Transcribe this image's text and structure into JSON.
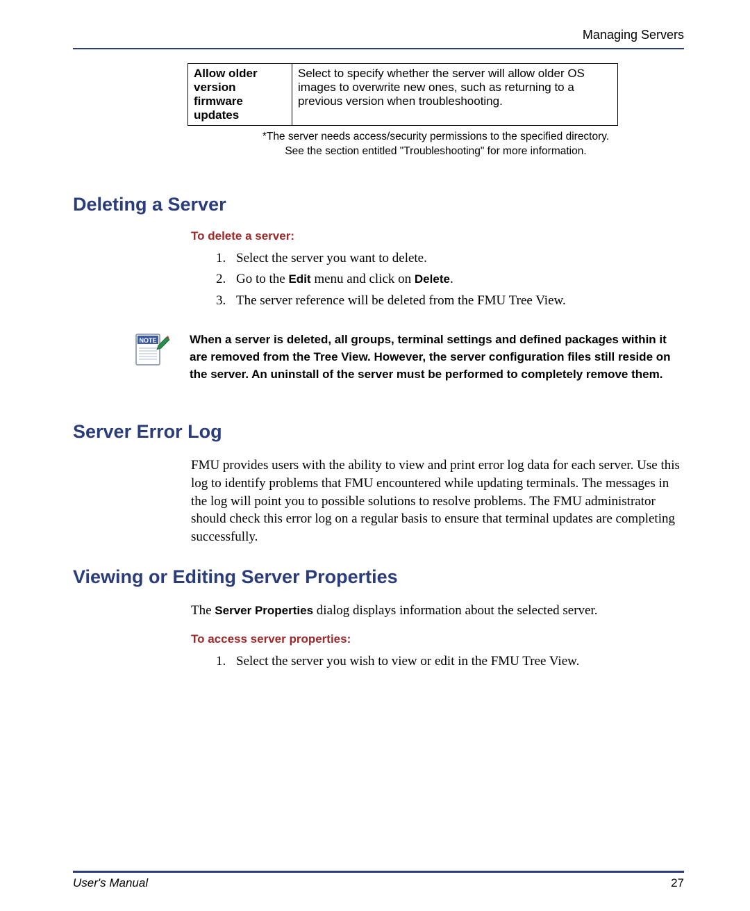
{
  "header": {
    "section": "Managing Servers"
  },
  "table": {
    "label": "Allow older version firmware updates",
    "description": "Select to specify whether the server will allow older OS images to overwrite new ones, such as returning to a previous version when troubleshooting."
  },
  "footnote": {
    "line1": "*The server needs access/security permissions to the specified directory.",
    "line2": "See the section entitled \"Troubleshooting\" for more information."
  },
  "deleting": {
    "heading": "Deleting a Server",
    "subheading": "To delete a server:",
    "steps": [
      {
        "text": "Select the server you want to delete."
      },
      {
        "prefix": "Go to the ",
        "bold1": "Edit",
        "mid": " menu and click on ",
        "bold2": "Delete",
        "suffix": "."
      },
      {
        "text": "The server reference will be deleted from the FMU Tree View."
      }
    ]
  },
  "note": {
    "text": "When a server is deleted, all groups, terminal settings and defined packages within it are removed from the Tree View. However, the server configuration files still reside on the server. An uninstall of the server must be performed to completely remove them."
  },
  "errorlog": {
    "heading": "Server Error Log",
    "body": "FMU provides users with the ability to view and print error log data for each server. Use this log to identify problems that FMU encountered while updating terminals. The messages in the log will point you to possible solutions to resolve problems. The FMU administrator should check this error log on a regular basis to ensure that terminal updates are completing successfully."
  },
  "properties": {
    "heading": "Viewing or Editing Server Properties",
    "intro_prefix": "The ",
    "intro_bold": "Server Properties",
    "intro_suffix": " dialog displays information about the selected server.",
    "subheading": "To access server properties:",
    "step1": "Select the server you wish to view or edit in the FMU Tree View."
  },
  "footer": {
    "left": "User's Manual",
    "right": "27"
  }
}
